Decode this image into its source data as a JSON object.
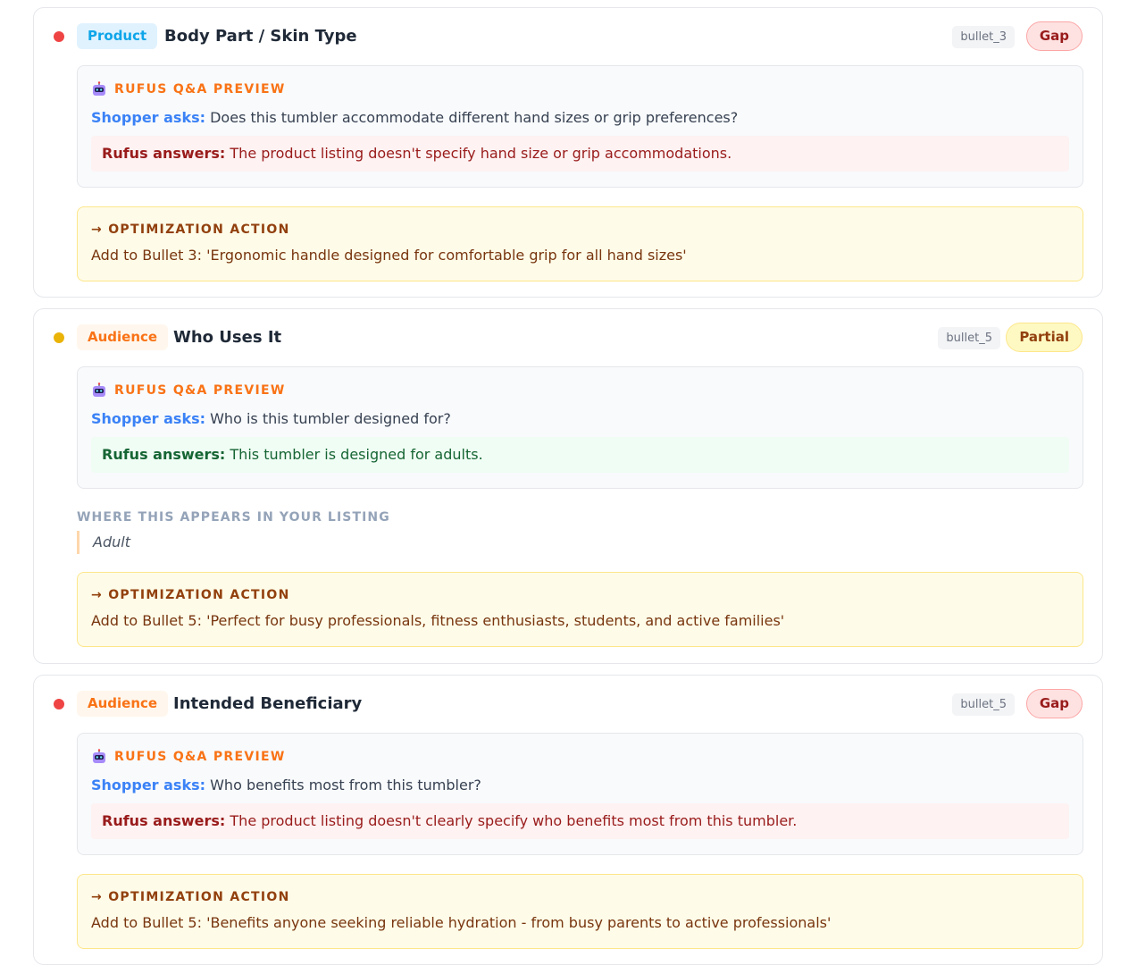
{
  "colors": {
    "gap_dot": "#ef4444",
    "partial_dot": "#eab308",
    "rufus_label": "#f97316",
    "shopper_label": "#3b82f6"
  },
  "cards": [
    {
      "dot_status": "gap",
      "category": "Product",
      "title": "Body Part / Skin Type",
      "bullet_ref": "bullet_3",
      "status": "Gap",
      "qa": {
        "icon": "robot-icon",
        "label": "RUFUS Q&A PREVIEW",
        "shopper_label": "Shopper asks:",
        "question": "Does this tumbler accommodate different hand sizes or grip preferences?",
        "answer_label": "Rufus answers:",
        "answer": "The product listing doesn't specify hand size or grip accommodations."
      },
      "action": {
        "label": "→ OPTIMIZATION ACTION",
        "text": "Add to Bullet 3: 'Ergonomic handle designed for comfortable grip for all hand sizes'"
      }
    },
    {
      "dot_status": "partial",
      "category": "Audience",
      "title": "Who Uses It",
      "bullet_ref": "bullet_5",
      "status": "Partial",
      "qa": {
        "icon": "robot-icon",
        "label": "RUFUS Q&A PREVIEW",
        "shopper_label": "Shopper asks:",
        "question": "Who is this tumbler designed for?",
        "answer_label": "Rufus answers:",
        "answer": "This tumbler is designed for adults."
      },
      "where": {
        "label": "WHERE THIS APPEARS IN YOUR LISTING",
        "quote": "Adult"
      },
      "action": {
        "label": "→ OPTIMIZATION ACTION",
        "text": "Add to Bullet 5: 'Perfect for busy professionals, fitness enthusiasts, students, and active families'"
      }
    },
    {
      "dot_status": "gap",
      "category": "Audience",
      "title": "Intended Beneficiary",
      "bullet_ref": "bullet_5",
      "status": "Gap",
      "qa": {
        "icon": "robot-icon",
        "label": "RUFUS Q&A PREVIEW",
        "shopper_label": "Shopper asks:",
        "question": "Who benefits most from this tumbler?",
        "answer_label": "Rufus answers:",
        "answer": "The product listing doesn't clearly specify who benefits most from this tumbler."
      },
      "action": {
        "label": "→ OPTIMIZATION ACTION",
        "text": "Add to Bullet 5: 'Benefits anyone seeking reliable hydration - from busy parents to active professionals'"
      }
    }
  ]
}
